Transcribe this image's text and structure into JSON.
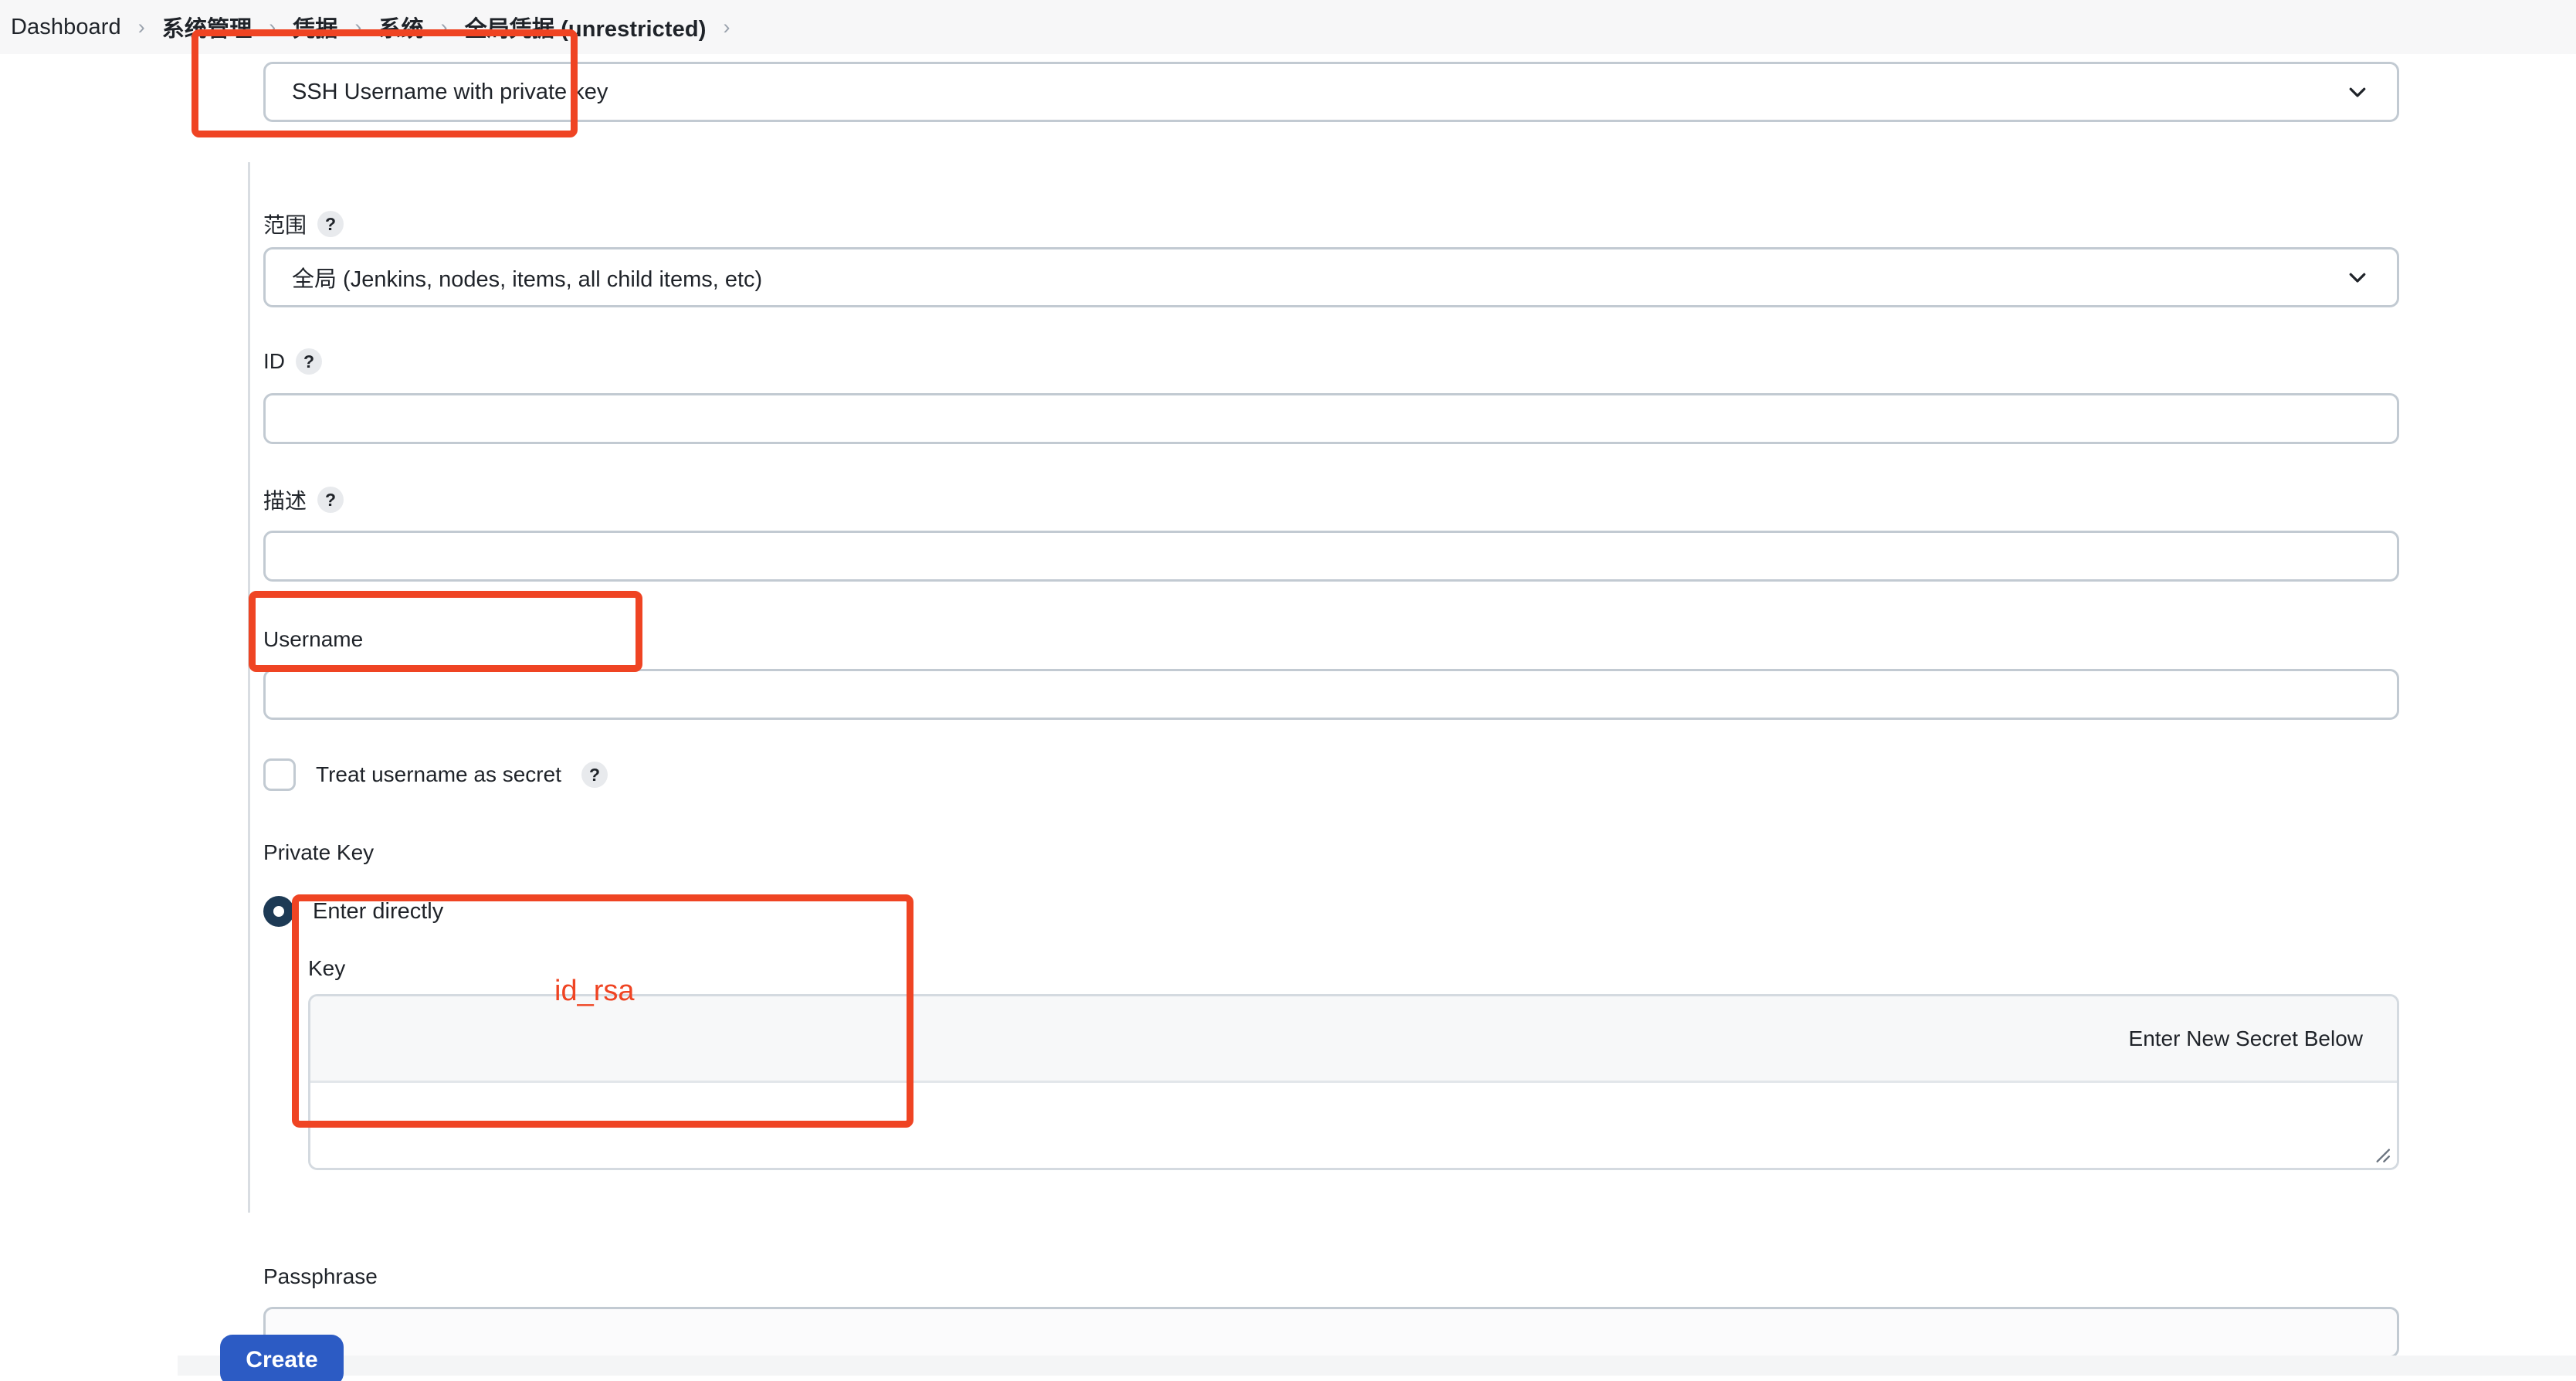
{
  "breadcrumb": {
    "items": [
      {
        "label": "Dashboard"
      },
      {
        "label": "系统管理"
      },
      {
        "label": "凭据"
      },
      {
        "label": "系统"
      },
      {
        "label": "全局凭据 (unrestricted)"
      }
    ],
    "separator": "›",
    "trailing_separator": "›"
  },
  "form": {
    "kind": {
      "name": "credential-kind-select",
      "value": "SSH Username with private key",
      "chevron": "chevron-down-icon"
    },
    "scope": {
      "label": "范围",
      "help": "?",
      "value": "全局 (Jenkins, nodes, items, all child items, etc)",
      "chevron": "chevron-down-icon"
    },
    "id": {
      "label": "ID",
      "help": "?",
      "value": "",
      "placeholder": ""
    },
    "description": {
      "label": "描述",
      "help": "?",
      "value": "",
      "placeholder": ""
    },
    "username": {
      "label": "Username",
      "value": "",
      "placeholder": ""
    },
    "treat_username_as_secret": {
      "label": "Treat username as secret",
      "help": "?",
      "checked": false
    },
    "private_key": {
      "section_label": "Private Key",
      "option_label": "Enter directly",
      "selected": true,
      "key_label": "Key",
      "secret_header_text": "Enter New Secret Below",
      "value": ""
    },
    "passphrase": {
      "label": "Passphrase",
      "value": "",
      "placeholder": ""
    }
  },
  "actions": {
    "create_label": "Create"
  },
  "annotations": {
    "kind_box": {
      "name": "kind-highlight"
    },
    "username_box": {
      "name": "username-highlight"
    },
    "key_box": {
      "name": "key-highlight"
    },
    "key_note": {
      "text": "id_rsa"
    }
  },
  "colors": {
    "annotation": "#ef4423",
    "primary_button": "#2c5bc4",
    "radio_selected": "#1d3a55",
    "breadcrumb_bg": "#f7f7f8"
  }
}
